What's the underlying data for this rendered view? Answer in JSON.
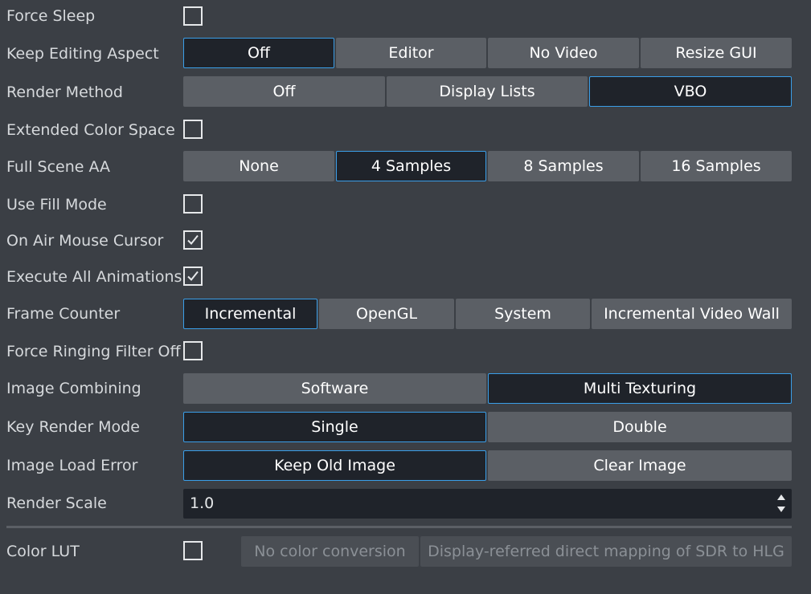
{
  "rows": {
    "force_sleep": {
      "label": "Force Sleep",
      "checked": false
    },
    "keep_editing_aspect": {
      "label": "Keep Editing Aspect",
      "options": [
        "Off",
        "Editor",
        "No Video",
        "Resize GUI"
      ],
      "selected": "Off"
    },
    "render_method": {
      "label": "Render Method",
      "options": [
        "Off",
        "Display Lists",
        "VBO"
      ],
      "selected": "VBO"
    },
    "extended_color_space": {
      "label": "Extended Color Space",
      "checked": false
    },
    "full_scene_aa": {
      "label": "Full Scene AA",
      "options": [
        "None",
        "4 Samples",
        "8 Samples",
        "16 Samples"
      ],
      "selected": "4 Samples"
    },
    "use_fill_mode": {
      "label": "Use Fill Mode",
      "checked": false
    },
    "on_air_mouse_cursor": {
      "label": "On Air Mouse Cursor",
      "checked": true
    },
    "execute_all_animations": {
      "label": "Execute All Animations",
      "checked": true
    },
    "frame_counter": {
      "label": "Frame Counter",
      "options": [
        "Incremental",
        "OpenGL",
        "System",
        "Incremental Video Wall"
      ],
      "selected": "Incremental"
    },
    "force_ringing_filter_off": {
      "label": "Force Ringing Filter Off",
      "checked": false
    },
    "image_combining": {
      "label": "Image Combining",
      "options": [
        "Software",
        "Multi Texturing"
      ],
      "selected": "Multi Texturing"
    },
    "key_render_mode": {
      "label": "Key Render Mode",
      "options": [
        "Single",
        "Double"
      ],
      "selected": "Single"
    },
    "image_load_error": {
      "label": "Image Load Error",
      "options": [
        "Keep Old Image",
        "Clear Image"
      ],
      "selected": "Keep Old Image"
    },
    "render_scale": {
      "label": "Render Scale",
      "value": "1.0"
    },
    "color_lut": {
      "label": "Color LUT",
      "checked": false,
      "options": [
        "No color conversion",
        "Display-referred direct mapping of SDR to HLG"
      ],
      "disabled": true
    }
  },
  "colors": {
    "background": "#3b3f45",
    "button": "#5b5f65",
    "selected": "#1f232a",
    "accent": "#3a9ee8"
  }
}
